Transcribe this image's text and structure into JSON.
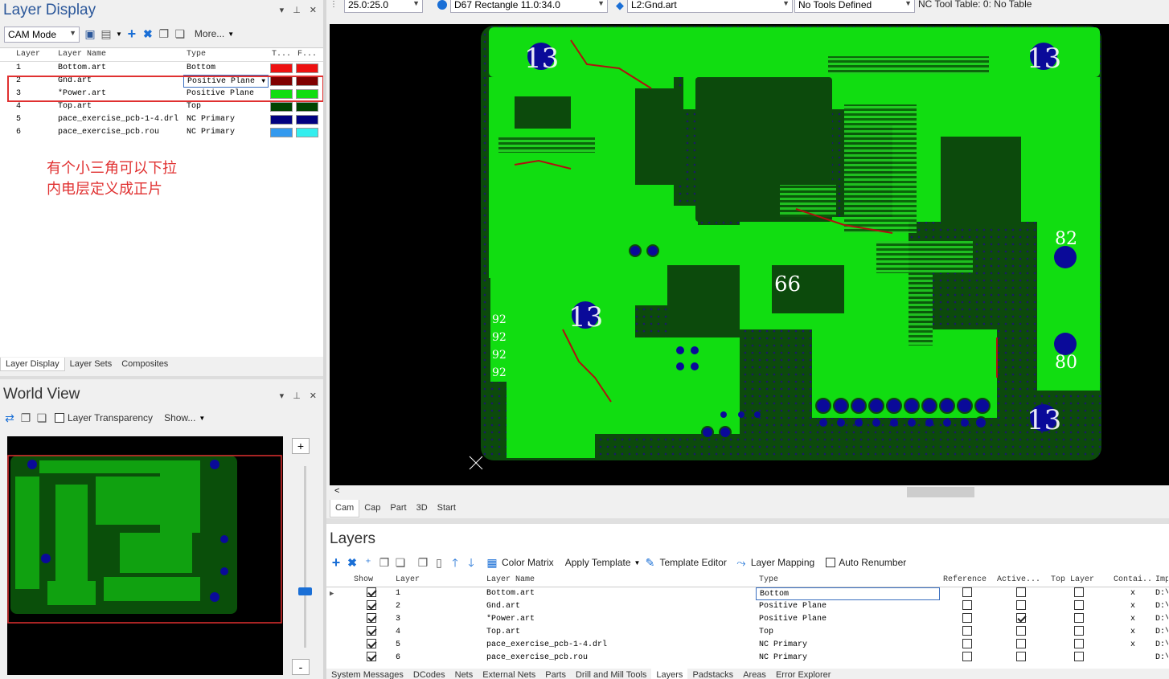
{
  "layer_display": {
    "title": "Layer Display",
    "mode": "CAM Mode",
    "more": "More...",
    "columns": [
      "Layer",
      "Layer Name",
      "Type",
      "T...",
      "F..."
    ],
    "rows": [
      {
        "num": "1",
        "name": "Bottom.art",
        "type": "Bottom",
        "c1": "#ee1111",
        "c2": "#ee1111"
      },
      {
        "num": "2",
        "name": "Gnd.art",
        "type": "Positive Plane",
        "c1": "#800000",
        "c2": "#800000"
      },
      {
        "num": "3",
        "name": "*Power.art",
        "type": "Positive Plane",
        "c1": "#11dd11",
        "c2": "#11dd11"
      },
      {
        "num": "4",
        "name": "Top.art",
        "type": "Top",
        "c1": "#004400",
        "c2": "#004400"
      },
      {
        "num": "5",
        "name": "pace_exercise_pcb-1-4.drl",
        "type": "NC Primary",
        "c1": "#000080",
        "c2": "#000080"
      },
      {
        "num": "6",
        "name": "pace_exercise_pcb.rou",
        "type": "NC Primary",
        "c1": "#3399ee",
        "c2": "#33eeee"
      }
    ],
    "annotation_line1": "有个小三角可以下拉",
    "annotation_line2": "内电层定义成正片",
    "tabs": [
      "Layer Display",
      "Layer Sets",
      "Composites"
    ]
  },
  "world_view": {
    "title": "World View",
    "transparency_label": "Layer Transparency",
    "show_label": "Show...",
    "zoom_in": "+",
    "zoom_out": "-"
  },
  "toolbar": {
    "grid": "25.0:25.0",
    "dcode": "D67   Rectangle 11.0:34.0",
    "layer": "L2:Gnd.art",
    "tools": "No Tools Defined",
    "nc_table": "NC Tool Table: 0: No Table"
  },
  "canvas_labels": [
    "13",
    "13",
    "82",
    "66",
    "13",
    "80",
    "13",
    "92",
    "92",
    "92",
    "92"
  ],
  "view_tabs": [
    "Cam",
    "Cap",
    "Part",
    "3D",
    "Start"
  ],
  "layers_panel": {
    "title": "Layers",
    "color_matrix": "Color Matrix",
    "apply_template": "Apply Template",
    "template_editor": "Template Editor",
    "layer_mapping": "Layer Mapping",
    "auto_renumber": "Auto Renumber",
    "columns": [
      "Show",
      "Layer",
      "Layer Name",
      "Type",
      "Reference",
      "Active...",
      "Top Layer",
      "Contai...",
      "Imp"
    ],
    "rows": [
      {
        "layer": "1",
        "name": "Bottom.art",
        "type": "Bottom",
        "active": false,
        "contain": "x",
        "imp": "D:\\"
      },
      {
        "layer": "2",
        "name": "Gnd.art",
        "type": "Positive Plane",
        "active": false,
        "contain": "x",
        "imp": "D:\\"
      },
      {
        "layer": "3",
        "name": "*Power.art",
        "type": "Positive Plane",
        "active": true,
        "contain": "x",
        "imp": "D:\\"
      },
      {
        "layer": "4",
        "name": "Top.art",
        "type": "Top",
        "active": false,
        "contain": "x",
        "imp": "D:\\"
      },
      {
        "layer": "5",
        "name": "pace_exercise_pcb-1-4.drl",
        "type": "NC Primary",
        "active": false,
        "contain": "x",
        "imp": "D:\\"
      },
      {
        "layer": "6",
        "name": "pace_exercise_pcb.rou",
        "type": "NC Primary",
        "active": false,
        "contain": "",
        "imp": "D:\\"
      }
    ]
  },
  "bottom_tabs": [
    "System Messages",
    "DCodes",
    "Nets",
    "External Nets",
    "Parts",
    "Drill and Mill Tools",
    "Layers",
    "Padstacks",
    "Areas",
    "Error Explorer"
  ]
}
